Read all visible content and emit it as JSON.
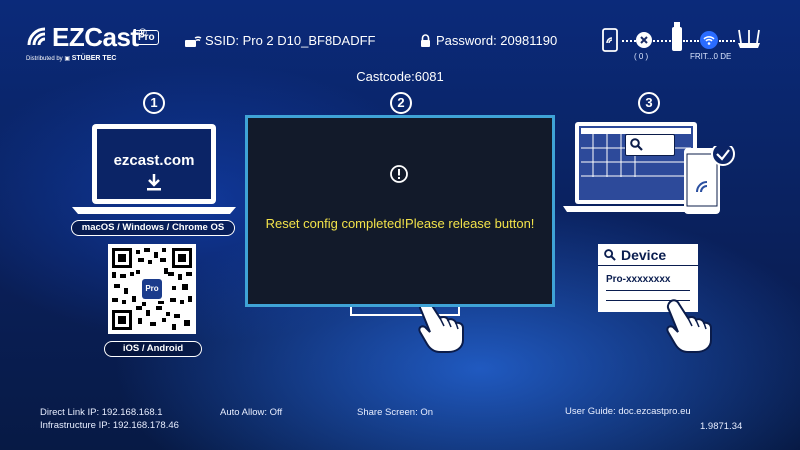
{
  "header": {
    "brand": "EZCast",
    "brand_reg": "®",
    "brand_badge": "Pro",
    "distributed_prefix": "Distributed by",
    "distributor": "STÜBER TEC",
    "ssid": "SSID: Pro 2 D10_BF8DADFF",
    "password": "Password: 20981190",
    "castcode": "Castcode:6081"
  },
  "status_chain": {
    "device_count": "( 0 )",
    "network_name": "FRIT...0 DE",
    "icons": [
      "phone-icon",
      "disconnected-icon",
      "dongle-icon",
      "wifi-icon",
      "router-icon"
    ]
  },
  "steps": {
    "step1_number": "1",
    "step2_number": "2",
    "step3_number": "3",
    "laptop_url": "ezcast.com",
    "os_label": "macOS / Windows / Chrome OS",
    "qr_badge": "Pro",
    "mobile_label": "iOS / Android",
    "device_title": "Device",
    "device_name": "Pro-xxxxxxxx"
  },
  "dialog": {
    "message": "Reset config completed!Please release button!"
  },
  "footer": {
    "direct_link": "Direct Link IP: 192.168.168.1",
    "infrastructure": "Infrastructure IP: 192.168.178.46",
    "auto_allow": "Auto Allow: Off",
    "share_screen": "Share Screen: On",
    "user_guide": "User Guide: doc.ezcastpro.eu",
    "version": "1.9871.34"
  },
  "colors": {
    "dialog_border": "#3fa3d6",
    "dialog_text": "#f2e24a",
    "background": "#0a2466"
  }
}
